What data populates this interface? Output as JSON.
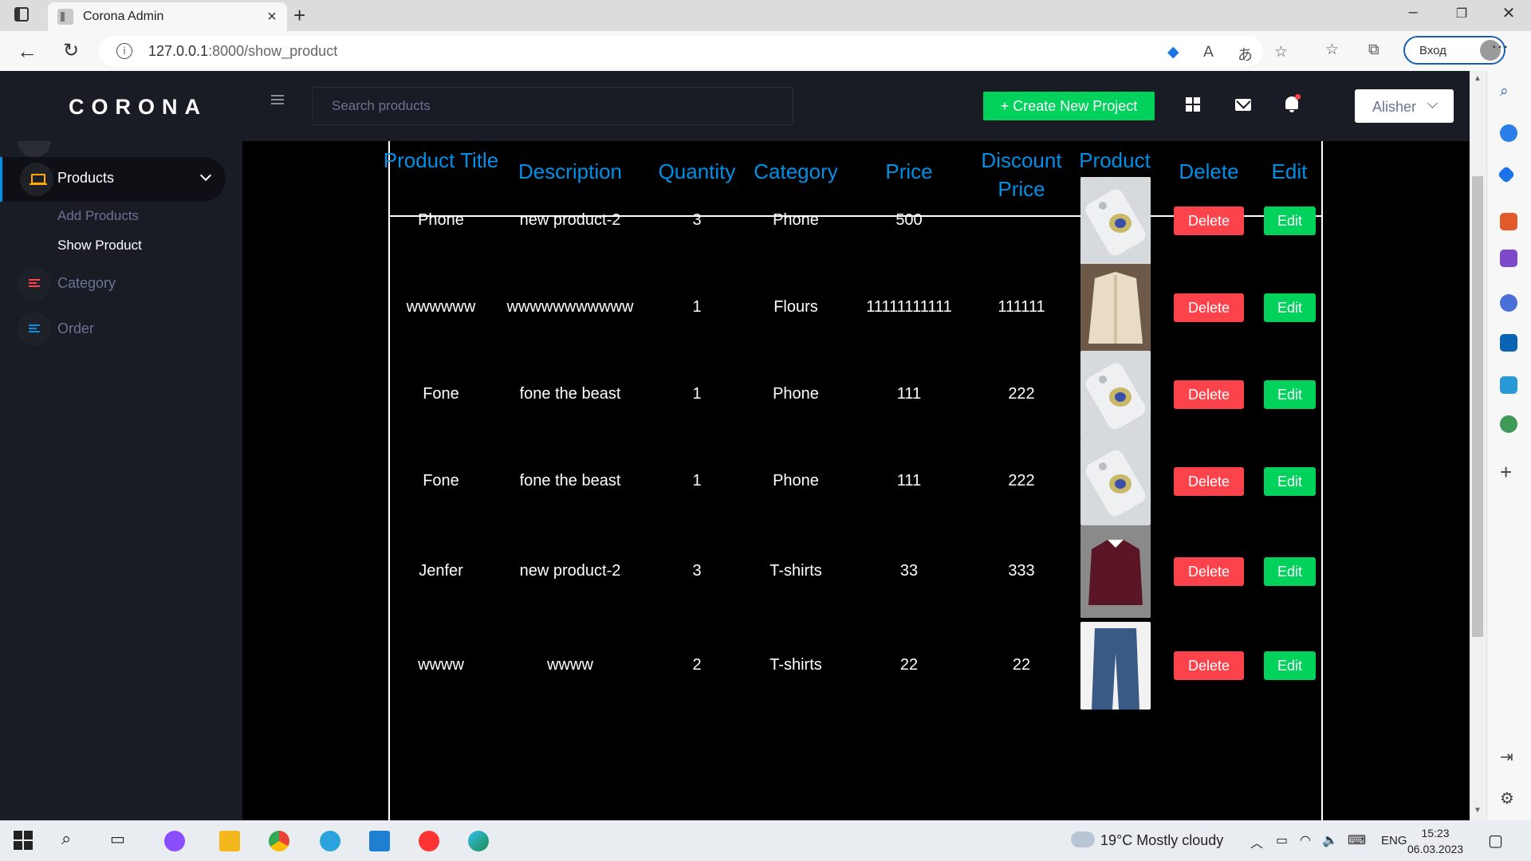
{
  "browser": {
    "tab_title": "Corona Admin",
    "url_host": "127.0.0.1",
    "url_path": ":8000/show_product",
    "login_label": "Вход"
  },
  "app": {
    "brand": "CORONA",
    "search_placeholder": "Search products",
    "create_button": "+ Create New Project",
    "user_name": "Alisher"
  },
  "sidebar": {
    "products_label": "Products",
    "sub_items": [
      "Add Products",
      "Show Product"
    ],
    "category_label": "Category",
    "order_label": "Order"
  },
  "table": {
    "headers": [
      "Product Title",
      "Description",
      "Quantity",
      "Category",
      "Price",
      "Discount Price",
      "Product Image",
      "Delete",
      "Edit"
    ],
    "rows": [
      {
        "title": "Phone",
        "description": "new product-2",
        "quantity": "3",
        "category": "Phone",
        "price": "500",
        "discount": "",
        "image": "phone"
      },
      {
        "title": "wwwwww",
        "description": "wwwwwwwwwww",
        "quantity": "1",
        "category": "Flours",
        "price": "11111111111",
        "discount": "111111",
        "image": "jacket"
      },
      {
        "title": "Fone",
        "description": "fone the beast",
        "quantity": "1",
        "category": "Phone",
        "price": "111",
        "discount": "222",
        "image": "phone"
      },
      {
        "title": "Fone",
        "description": "fone the beast",
        "quantity": "1",
        "category": "Phone",
        "price": "111",
        "discount": "222",
        "image": "phone"
      },
      {
        "title": "Jenfer",
        "description": "new product-2",
        "quantity": "3",
        "category": "T-shirts",
        "price": "33",
        "discount": "333",
        "image": "sweater"
      },
      {
        "title": "wwww",
        "description": "wwww",
        "quantity": "2",
        "category": "T-shirts",
        "price": "22",
        "discount": "22",
        "image": "jeans"
      }
    ],
    "delete_label": "Delete",
    "edit_label": "Edit"
  },
  "taskbar": {
    "weather": "19°C  Mostly cloudy",
    "lang": "ENG",
    "time": "15:23",
    "date": "06.03.2023"
  },
  "colors": {
    "sidebar_bg": "#191c24",
    "accent_blue": "#0090e7",
    "success": "#00d25b",
    "danger": "#fc424a"
  }
}
